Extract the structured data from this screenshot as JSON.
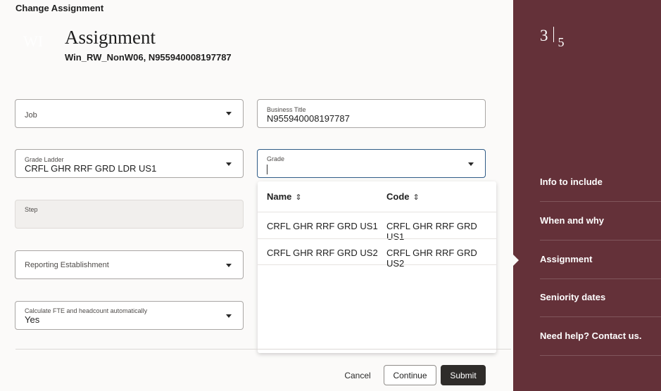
{
  "header": {
    "label": "Change Assignment"
  },
  "person": {
    "avatar": "WI",
    "title": "Assignment",
    "subtitle": "Win_RW_NonW06, N955940008197787"
  },
  "fields": {
    "job": {
      "label": "Job"
    },
    "business_title": {
      "label": "Business Title",
      "value": "N955940008197787"
    },
    "grade_ladder": {
      "label": "Grade Ladder",
      "value": "CRFL GHR RRF GRD LDR US1"
    },
    "grade": {
      "label": "Grade"
    },
    "step": {
      "label": "Step"
    },
    "reporting_establishment": {
      "label": "Reporting Establishment"
    },
    "calc_fte": {
      "label": "Calculate FTE and headcount automatically",
      "value": "Yes"
    }
  },
  "grade_dropdown": {
    "columns": [
      "Name",
      "Code"
    ],
    "sort_icon": "sort-updown-icon",
    "rows": [
      {
        "name": "CRFL GHR RRF GRD US1",
        "code": "CRFL GHR RRF GRD US1"
      },
      {
        "name": "CRFL GHR RRF GRD US2",
        "code": "CRFL GHR RRF GRD US2"
      }
    ]
  },
  "buttons": {
    "cancel": "Cancel",
    "continue": "Continue",
    "submit": "Submit"
  },
  "progress": {
    "current": "3",
    "total": "5"
  },
  "side_nav": {
    "items": [
      "Info to include",
      "When and why",
      "Assignment",
      "Seniority dates",
      "Need help? Contact us."
    ],
    "active_index": 2
  },
  "colors": {
    "side_panel": "#643139",
    "submit_bg": "#2f2c2a",
    "focus_border": "#2f5b86"
  }
}
